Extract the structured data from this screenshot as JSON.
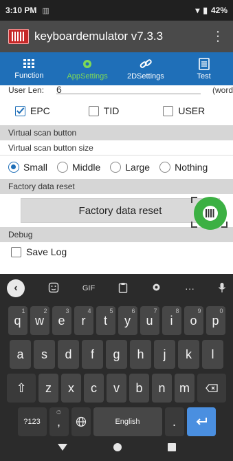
{
  "status": {
    "time": "3:10 PM",
    "battery": "42%"
  },
  "appbar": {
    "title": "keyboardemulator v7.3.3"
  },
  "tabs": [
    {
      "label": "Function",
      "icon": "grid-icon"
    },
    {
      "label": "AppSettings",
      "icon": "gear-icon"
    },
    {
      "label": "2DSettings",
      "icon": "link-icon"
    },
    {
      "label": "Test",
      "icon": "list-icon"
    }
  ],
  "userlen": {
    "label": "User Len:",
    "value": "6",
    "suffix": "(word"
  },
  "checks": {
    "epc": "EPC",
    "tid": "TID",
    "user": "USER"
  },
  "sections": {
    "virtual": "Virtual scan button",
    "size_label": "Virtual scan button size",
    "factory": "Factory data reset",
    "debug": "Debug"
  },
  "radios": {
    "small": "Small",
    "middle": "Middle",
    "large": "Large",
    "nothing": "Nothing"
  },
  "reset_button": "Factory data reset",
  "save_log": "Save Log",
  "keyboard": {
    "gif": "GIF",
    "row1": [
      "q",
      "w",
      "e",
      "r",
      "t",
      "y",
      "u",
      "i",
      "o",
      "p"
    ],
    "row1_hints": [
      "1",
      "2",
      "3",
      "4",
      "5",
      "6",
      "7",
      "8",
      "9",
      "0"
    ],
    "row2": [
      "a",
      "s",
      "d",
      "f",
      "g",
      "h",
      "j",
      "k",
      "l"
    ],
    "row3": [
      "z",
      "x",
      "c",
      "v",
      "b",
      "n",
      "m"
    ],
    "sym": "?123",
    "comma": ",",
    "space": "English",
    "period": "."
  }
}
